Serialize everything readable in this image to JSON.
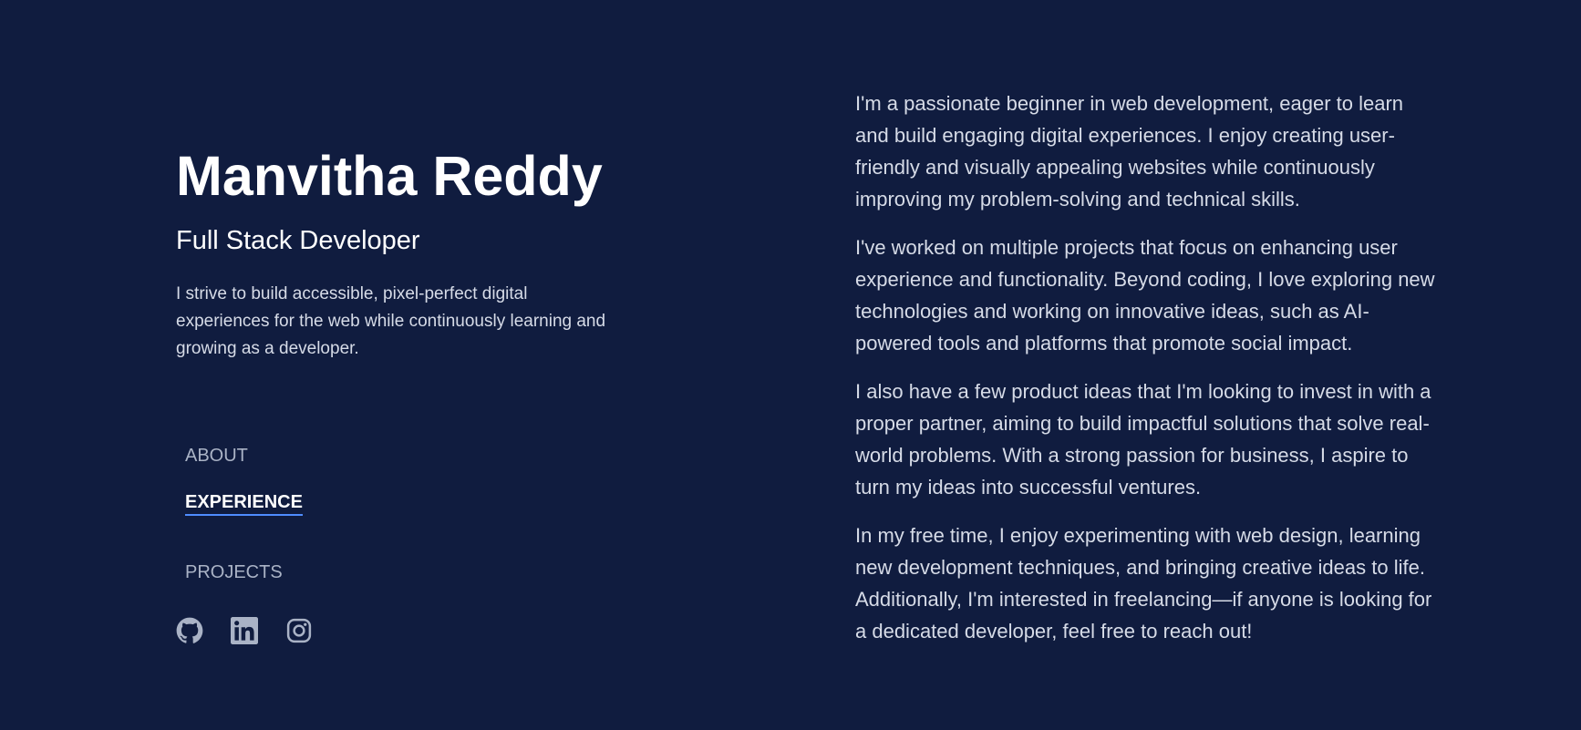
{
  "profile": {
    "name": "Manvitha Reddy",
    "role": "Full Stack Developer",
    "tagline": "I strive to build accessible, pixel-perfect digital experiences for the web while continuously learning and growing as a developer."
  },
  "nav": {
    "items": [
      {
        "label": "ABOUT",
        "active": false
      },
      {
        "label": "EXPERIENCE",
        "active": true
      },
      {
        "label": "PROJECTS",
        "active": false
      }
    ]
  },
  "social": {
    "icons": [
      "github-icon",
      "linkedin-icon",
      "instagram-icon"
    ]
  },
  "about": {
    "paragraphs": [
      "I'm a passionate beginner in web development, eager to learn and build engaging digital experiences. I enjoy creating user-friendly and visually appealing websites while continuously improving my problem-solving and technical skills.",
      "I've worked on multiple projects that focus on enhancing user experience and functionality. Beyond coding, I love exploring new technologies and working on innovative ideas, such as AI-powered tools and platforms that promote social impact.",
      "I also have a few product ideas that I'm looking to invest in with a proper partner, aiming to build impactful solutions that solve real-world problems. With a strong passion for business, I aspire to turn my ideas into successful ventures.",
      "In my free time, I enjoy experimenting with web design, learning new development techniques, and bringing creative ideas to life. Additionally, I'm interested in freelancing—if anyone is looking for a dedicated developer, feel free to reach out!"
    ]
  },
  "colors": {
    "background": "#101c3f",
    "accent": "#4f8cff",
    "text_primary": "#ffffff",
    "text_muted": "#aab3c6",
    "text_body": "#d6dbe7"
  }
}
